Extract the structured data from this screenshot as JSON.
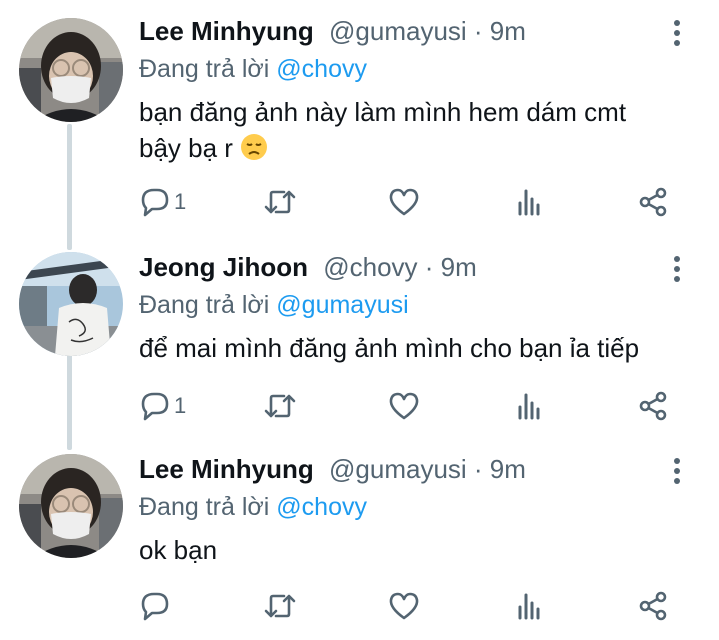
{
  "tweets": [
    {
      "name": "Lee Minhyung",
      "handle": "@gumayusi",
      "time": "· 9m",
      "replying_prefix": "Đang trả lời",
      "replying_to": "@chovy",
      "text_line1": "bạn đăng ảnh này làm mình hem dám cmt",
      "text_line2": "bậy bạ r",
      "emoji": "disappointed-face-icon",
      "reply_count": "1"
    },
    {
      "name": "Jeong Jihoon",
      "handle": "@chovy",
      "time": "· 9m",
      "replying_prefix": "Đang trả lời",
      "replying_to": "@gumayusi",
      "text_line1": "để mai mình đăng ảnh mình cho bạn ỉa tiếp",
      "reply_count": "1"
    },
    {
      "name": "Lee Minhyung",
      "handle": "@gumayusi",
      "time": "· 9m",
      "replying_prefix": "Đang trả lời",
      "replying_to": "@chovy",
      "text_line1": "ok bạn",
      "reply_count": ""
    }
  ],
  "colors": {
    "link": "#1d9bf0",
    "secondary": "#536471",
    "thread_line": "#cfd9de"
  },
  "icons": [
    "reply-icon",
    "retweet-icon",
    "like-icon",
    "analytics-icon",
    "share-icon",
    "more-options-icon"
  ]
}
